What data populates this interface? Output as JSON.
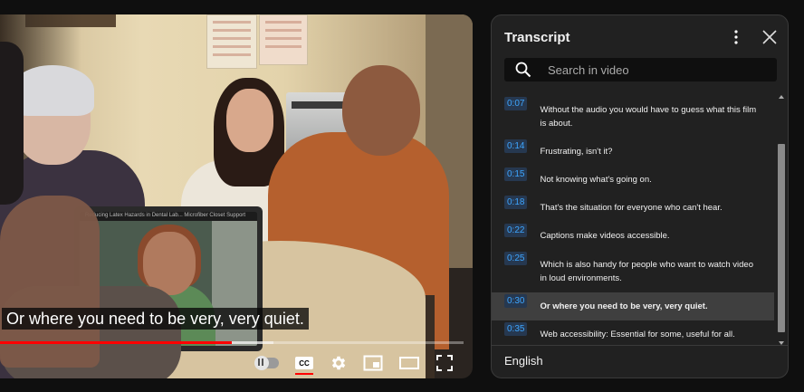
{
  "player": {
    "caption_text": "Or where you need to be very, very quiet.",
    "laptop_screen_title": "Reducing Latex Hazards in Dental Lab... Microfiber Closet Support",
    "progress": {
      "played_fraction": 0.5,
      "loaded_fraction": 0.59,
      "played_color": "#ff0000"
    },
    "controls": [
      {
        "name": "autoplay-toggle",
        "icon": "pause-toggle-icon"
      },
      {
        "name": "subtitles-button",
        "icon": "cc-icon",
        "label": "CC"
      },
      {
        "name": "settings-button",
        "icon": "gear-icon"
      },
      {
        "name": "miniplayer-button",
        "icon": "miniplayer-icon"
      },
      {
        "name": "theater-mode-button",
        "icon": "theater-icon"
      },
      {
        "name": "fullscreen-button",
        "icon": "fullscreen-icon"
      }
    ]
  },
  "transcript": {
    "title": "Transcript",
    "search_placeholder": "Search in video",
    "segments": [
      {
        "time": "0:07",
        "text": "Without the audio you would have to guess what this film is about."
      },
      {
        "time": "0:14",
        "text": "Frustrating, isn't it?"
      },
      {
        "time": "0:15",
        "text": "Not knowing what's going on."
      },
      {
        "time": "0:18",
        "text": "That's the situation for everyone who can't hear."
      },
      {
        "time": "0:22",
        "text": "Captions make videos accessible."
      },
      {
        "time": "0:25",
        "text": "Which is also handy for people who want to watch video in loud environments."
      },
      {
        "time": "0:30",
        "text": "Or where you need to be very, very quiet."
      },
      {
        "time": "0:35",
        "text": "Web accessibility: Essential for some, useful for all."
      }
    ],
    "active_segment_index": 6,
    "language": "English"
  },
  "colors": {
    "timestamp_text": "#3ea6ff",
    "timestamp_bg": "#263850",
    "panel_bg": "#212121",
    "active_row_bg": "#3f3f3f"
  }
}
